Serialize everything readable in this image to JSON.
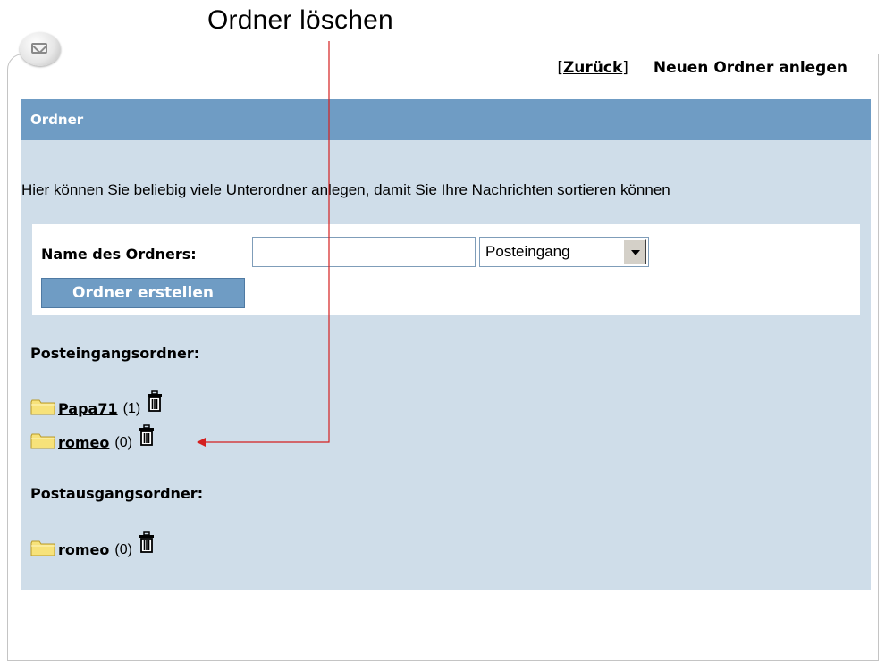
{
  "annotation": {
    "label": "Ordner löschen"
  },
  "header": {
    "bracket_open": "[",
    "back_label": "Zurück",
    "bracket_close": "]",
    "new_folder_label": "Neuen Ordner anlegen"
  },
  "panel": {
    "title": "Ordner",
    "intro": "Hier können Sie beliebig viele Unterordner anlegen, damit Sie Ihre Nachrichten sortieren können"
  },
  "form": {
    "name_label": "Name des Ordners:",
    "name_value": "",
    "select_value": "Posteingang",
    "create_button": "Ordner erstellen"
  },
  "inbox": {
    "title": "Posteingangsordner:",
    "folders": [
      {
        "name": "Papa71",
        "count": "(1)"
      },
      {
        "name": "romeo",
        "count": "(0)"
      }
    ]
  },
  "outbox": {
    "title": "Postausgangsordner:",
    "folders": [
      {
        "name": "romeo",
        "count": "(0)"
      }
    ]
  },
  "colors": {
    "panel_bg": "#cfdde9",
    "header_bg": "#6f9cc4",
    "annotation_line": "#d42020"
  },
  "icons": [
    "mail-icon",
    "folder-icon",
    "trash-icon",
    "dropdown-arrow-icon"
  ]
}
